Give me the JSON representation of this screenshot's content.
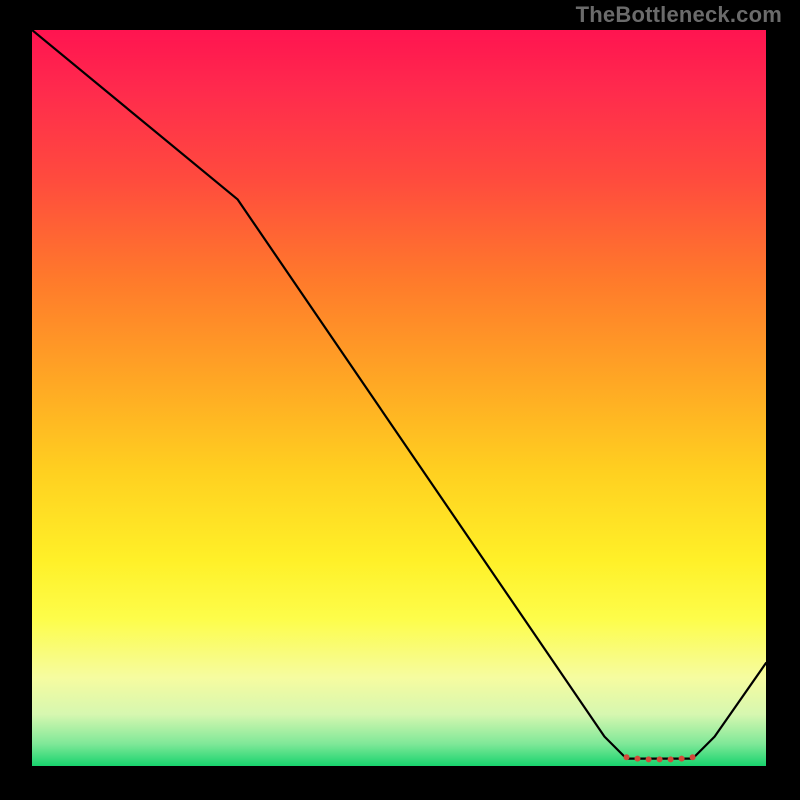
{
  "attribution": "TheBottleneck.com",
  "chart_data": {
    "type": "line",
    "title": "",
    "xlabel": "",
    "ylabel": "",
    "ylim": [
      0,
      100
    ],
    "xlim": [
      0,
      100
    ],
    "series": [
      {
        "name": "curve",
        "x": [
          0,
          28,
          78,
          81,
          90,
          93,
          100
        ],
        "values": [
          100,
          77,
          4,
          1,
          1,
          4,
          14
        ]
      }
    ],
    "markers": {
      "name": "highlight-dots",
      "x": [
        81,
        82.5,
        84,
        85.5,
        87,
        88.5,
        90
      ],
      "values": [
        1.2,
        1.0,
        0.9,
        0.9,
        0.9,
        1.0,
        1.2
      ]
    },
    "gradient_stops": [
      {
        "pos": 0.0,
        "color": "#ff1450"
      },
      {
        "pos": 0.5,
        "color": "#ffa824"
      },
      {
        "pos": 0.8,
        "color": "#fdfd4a"
      },
      {
        "pos": 1.0,
        "color": "#18d36d"
      }
    ]
  }
}
